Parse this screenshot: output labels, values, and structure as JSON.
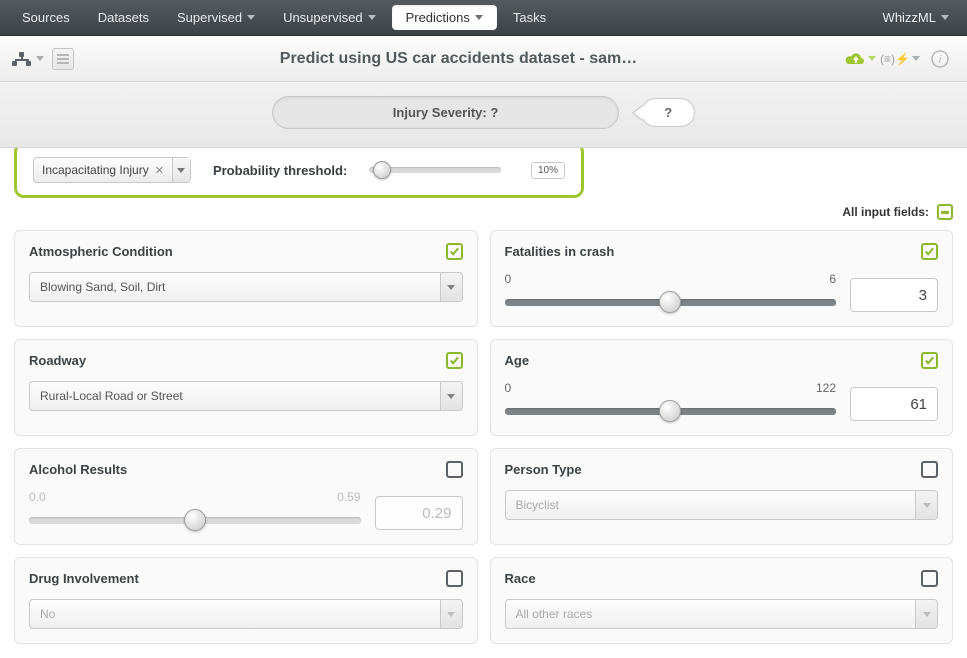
{
  "nav": {
    "items": [
      "Sources",
      "Datasets",
      "Supervised",
      "Unsupervised",
      "Predictions",
      "Tasks"
    ],
    "active_index": 4,
    "right_label": "WhizzML"
  },
  "header": {
    "title": "Predict using US car accidents dataset - sam…"
  },
  "subheader": {
    "label": "Injury Severity: ?",
    "bubble": "?"
  },
  "threshold": {
    "class_value": "Incapacitating Injury",
    "label": "Probability threshold:",
    "percent_text": "10%",
    "percent": 10
  },
  "all_fields_label": "All input fields:",
  "panels": [
    {
      "id": "atmos",
      "title": "Atmospheric Condition",
      "type": "select",
      "selected": "Blowing Sand, Soil, Dirt",
      "checked": true
    },
    {
      "id": "fatalities",
      "title": "Fatalities in crash",
      "type": "range",
      "min": "0",
      "max": "6",
      "value": "3",
      "percent": 50,
      "checked": true
    },
    {
      "id": "roadway",
      "title": "Roadway",
      "type": "select",
      "selected": "Rural-Local Road or Street",
      "checked": true
    },
    {
      "id": "age",
      "title": "Age",
      "type": "range",
      "min": "0",
      "max": "122",
      "value": "61",
      "percent": 50,
      "checked": true
    },
    {
      "id": "alcohol",
      "title": "Alcohol Results",
      "type": "range",
      "min": "0.0",
      "max": "0.59",
      "value": "0.29",
      "percent": 50,
      "checked": false
    },
    {
      "id": "persontype",
      "title": "Person Type",
      "type": "select",
      "selected": "Bicyclist",
      "checked": false
    },
    {
      "id": "drug",
      "title": "Drug Involvement",
      "type": "select",
      "selected": "No",
      "checked": false
    },
    {
      "id": "race",
      "title": "Race",
      "type": "select",
      "selected": "All other races",
      "checked": false
    }
  ]
}
